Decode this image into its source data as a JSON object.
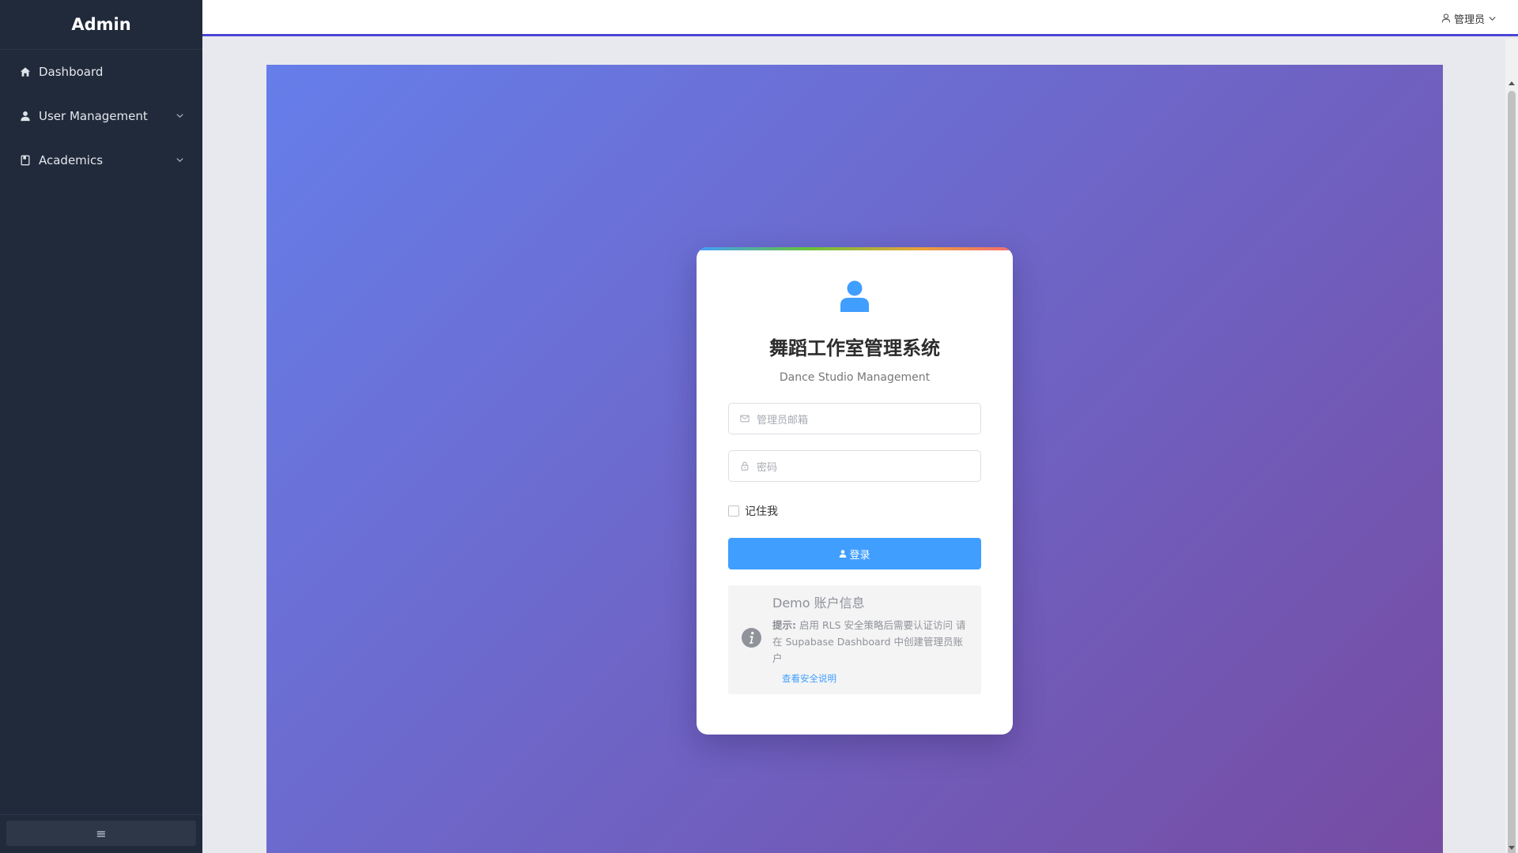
{
  "sidebar": {
    "brand": "Admin",
    "items": [
      {
        "label": "Dashboard",
        "icon": "home-icon",
        "has_submenu": false
      },
      {
        "label": "User Management",
        "icon": "user-icon",
        "has_submenu": true
      },
      {
        "label": "Academics",
        "icon": "book-icon",
        "has_submenu": true
      }
    ],
    "collapse_icon": "≡"
  },
  "header": {
    "user_menu_label": "管理员",
    "accent_color": "#4b45d6"
  },
  "login": {
    "title": "舞蹈工作室管理系统",
    "subtitle": "Dance Studio Management",
    "email_placeholder": "管理员邮箱",
    "password_placeholder": "密码",
    "remember_label": "记住我",
    "login_button": "登录",
    "demo": {
      "title": "Demo 账户信息",
      "hint_label": "提示:",
      "hint_text": " 启用 RLS 安全策略后需要认证访问 请在 Supabase Dashboard 中创建管理员账户",
      "link": "查看安全说明"
    }
  },
  "colors": {
    "sidebar_bg": "#212a3a",
    "primary": "#409eff",
    "hero_gradient_start": "#667eea",
    "hero_gradient_end": "#764ba2"
  }
}
